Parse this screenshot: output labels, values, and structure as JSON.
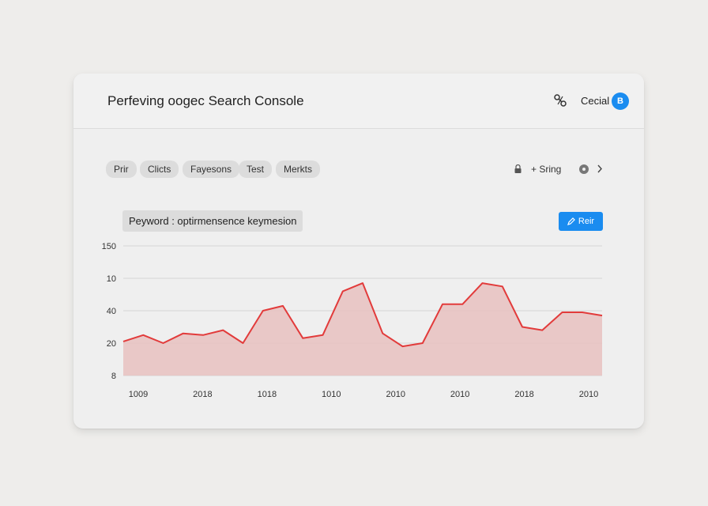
{
  "header": {
    "title": "Perfeving oogec Search Console",
    "user_label": "Cecial",
    "avatar_letter": "B"
  },
  "chips": [
    "Prir",
    "Clicts",
    "Fayesons",
    "Test",
    "Merkts"
  ],
  "toolbar": {
    "add_label": "+ Sring"
  },
  "filter": {
    "label": "Peyword : optirmensence keymesion"
  },
  "action_button": {
    "label": "Reir"
  },
  "colors": {
    "accent": "#1a8cf0",
    "series_line": "#e23b3b",
    "series_fill": "#e8c1bf"
  },
  "icons": [
    "share-icon",
    "lock-icon",
    "settings-icon",
    "chevron-right-icon",
    "pencil-icon"
  ],
  "chart_data": {
    "type": "area",
    "y_tick_labels": [
      "150",
      "10",
      "40",
      "20",
      "8"
    ],
    "x_tick_labels": [
      "1009",
      "2018",
      "1018",
      "1010",
      "2010",
      "2010",
      "2018",
      "2010"
    ],
    "values": [
      21,
      25,
      20,
      26,
      25,
      28,
      20,
      40,
      43,
      23,
      25,
      52,
      57,
      26,
      18,
      20,
      44,
      44,
      57,
      55,
      30,
      28,
      39,
      39,
      37
    ],
    "ylim": [
      0,
      80
    ],
    "grid": true,
    "legend": "none"
  }
}
